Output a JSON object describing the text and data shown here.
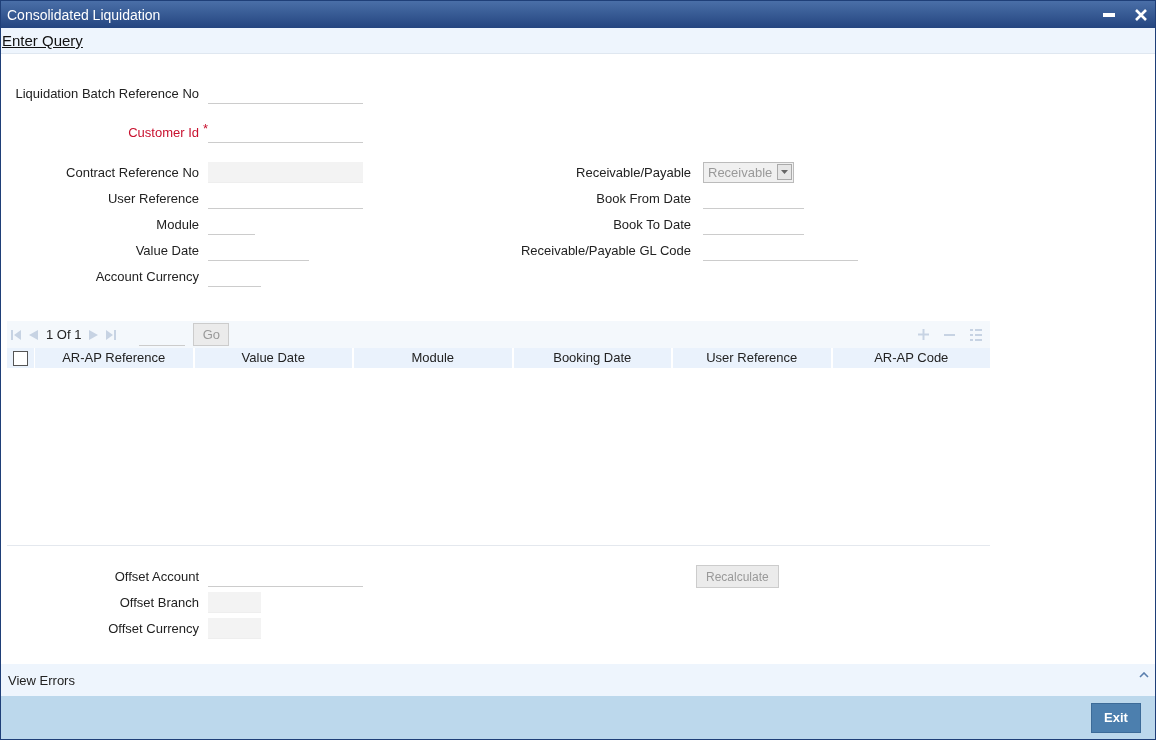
{
  "window": {
    "title": "Consolidated Liquidation"
  },
  "menu": {
    "label": "Enter Query"
  },
  "top_fields": [
    {
      "label": "Liquidation Batch Reference No",
      "kind": "text",
      "required": false
    },
    {
      "label": "Customer Id",
      "kind": "text",
      "required": true,
      "required_mark": "*"
    }
  ],
  "left_fields": [
    {
      "label": "Contract Reference No",
      "kind": "readonly",
      "required": false
    },
    {
      "label": "User Reference",
      "kind": "text",
      "required": false
    },
    {
      "label": "Module",
      "kind": "text",
      "required": false
    },
    {
      "label": "Value Date",
      "kind": "text",
      "required": false
    },
    {
      "label": "Account Currency",
      "kind": "text",
      "required": false
    }
  ],
  "right_fields": [
    {
      "label": "Receivable/Payable",
      "kind": "select",
      "value": "Receivable",
      "disabled": true
    },
    {
      "label": "Book From Date",
      "kind": "text",
      "required": false
    },
    {
      "label": "Book To Date",
      "kind": "text",
      "required": false
    },
    {
      "label": "Receivable/Payable GL Code",
      "kind": "text",
      "required": false
    }
  ],
  "grid": {
    "pager": "1 Of 1",
    "go_button": {
      "label": "Go",
      "disabled": true
    },
    "select_all": {
      "checked": false
    },
    "columns": [
      "AR-AP Reference",
      "Value Date",
      "Module",
      "Booking Date",
      "User Reference",
      "AR-AP Code"
    ]
  },
  "bottom_fields": [
    {
      "label": "Offset Account",
      "kind": "text",
      "required": false
    },
    {
      "label": "Offset Branch",
      "kind": "readonly",
      "required": false
    },
    {
      "label": "Offset Currency",
      "kind": "readonly",
      "required": false
    }
  ],
  "recalculate_button": {
    "label": "Recalculate",
    "disabled": true
  },
  "errors_bar": {
    "label": "View Errors"
  },
  "footer": {
    "exit_button": {
      "label": "Exit"
    }
  }
}
